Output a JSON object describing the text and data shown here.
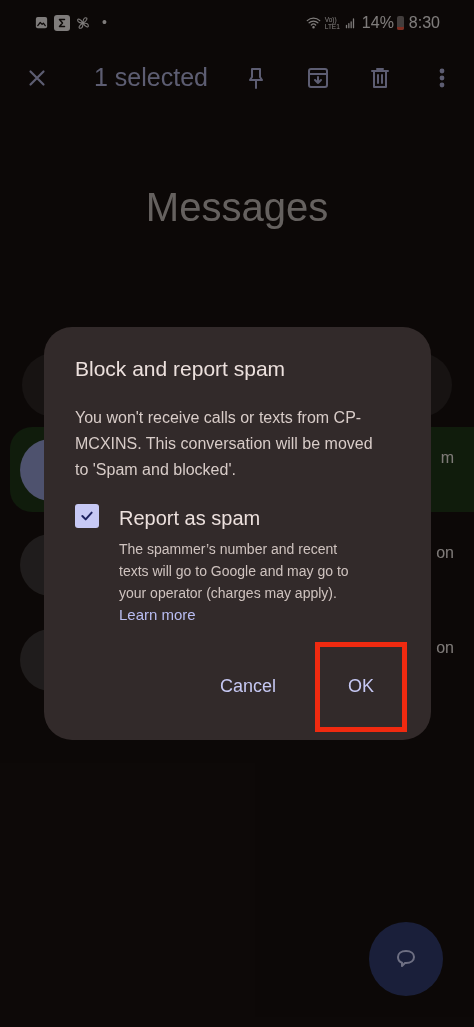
{
  "status_bar": {
    "dot": "•",
    "volte_top": "Vo))",
    "volte_bottom": "LTE1",
    "battery": "14%",
    "time": "8:30"
  },
  "toolbar": {
    "title": "1 selected"
  },
  "app_title": "Messages",
  "conversations": [
    {
      "snippet_fragment": "m",
      "selected": true
    },
    {
      "snippet_fragment": "on",
      "selected": false
    },
    {
      "snippet_fragment": "on",
      "selected": false
    }
  ],
  "dialog": {
    "title": "Block and report spam",
    "message": "You won't receive calls or texts from CP-MCXINS. This conversation will be moved to 'Spam and blocked'.",
    "checkbox": {
      "label": "Report as spam",
      "checked": true,
      "description": "The spammer’s number and recent texts will go to Google and may go to your operator (charges may apply).",
      "link": "Learn more"
    },
    "buttons": [
      {
        "label": "Cancel",
        "highlighted": false
      },
      {
        "label": "OK",
        "highlighted": true
      }
    ]
  }
}
